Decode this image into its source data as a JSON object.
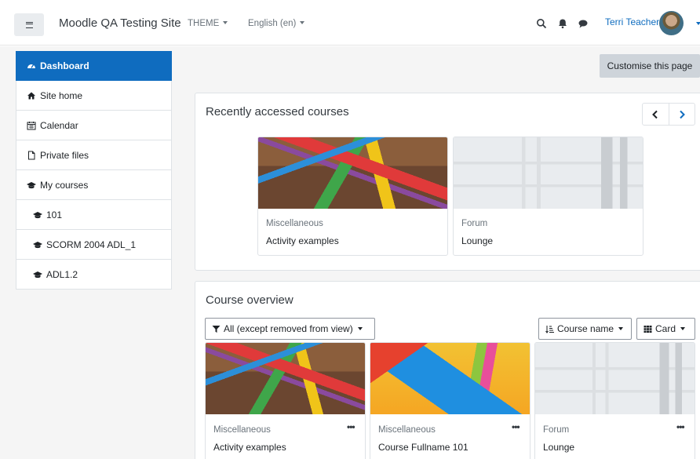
{
  "header": {
    "site_name": "Moodle QA Testing Site",
    "theme_menu": "THEME",
    "language_menu": "English (en)",
    "user_name": "Terri Teacher"
  },
  "sidebar": {
    "items": [
      {
        "label": "Dashboard",
        "icon": "dashboard-icon"
      },
      {
        "label": "Site home",
        "icon": "home-icon"
      },
      {
        "label": "Calendar",
        "icon": "calendar-icon"
      },
      {
        "label": "Private files",
        "icon": "file-icon"
      },
      {
        "label": "My courses",
        "icon": "graduation-cap-icon"
      },
      {
        "label": "101",
        "icon": "graduation-cap-icon"
      },
      {
        "label": "SCORM 2004 ADL_1",
        "icon": "graduation-cap-icon"
      },
      {
        "label": "ADL1.2",
        "icon": "graduation-cap-icon"
      }
    ]
  },
  "customise_button": "Customise this page",
  "recent": {
    "title": "Recently accessed courses",
    "cards": [
      {
        "category": "Miscellaneous",
        "name": "Activity examples"
      },
      {
        "category": "Forum",
        "name": "Lounge"
      }
    ]
  },
  "overview": {
    "title": "Course overview",
    "filter": "All (except removed from view)",
    "sort": "Course name",
    "view": "Card",
    "cards": [
      {
        "category": "Miscellaneous",
        "name": "Activity examples"
      },
      {
        "category": "Miscellaneous",
        "name": "Course Fullname 101"
      },
      {
        "category": "Forum",
        "name": "Lounge"
      }
    ],
    "menu_dots": "•••"
  },
  "colors": {
    "primary": "#0f6cbf",
    "page_bg": "#f5f5f5",
    "button_grey": "#ced4da"
  }
}
